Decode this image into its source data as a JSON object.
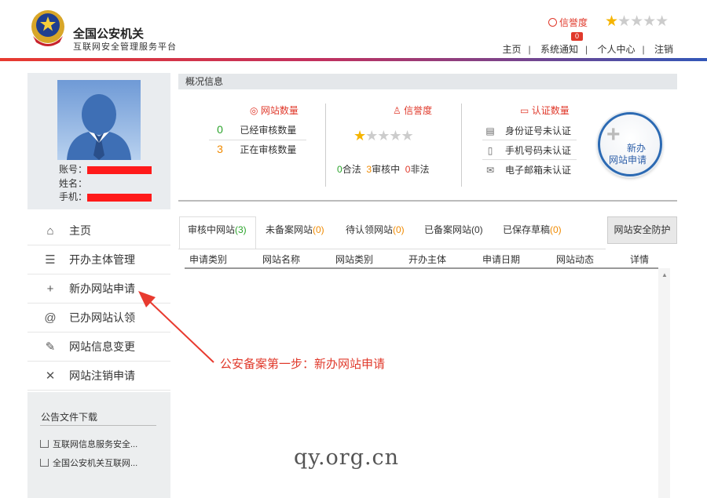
{
  "header": {
    "title": "全国公安机关",
    "subtitle": "互联网安全管理服务平台",
    "credit_label": "信誉度",
    "badge_count": "0",
    "rating": {
      "value": 1,
      "max": 5
    },
    "nav": [
      "主页",
      "系统通知",
      "个人中心",
      "注销"
    ]
  },
  "profile": {
    "account_label": "账号：",
    "name_label": "姓名：",
    "phone_label": "手机："
  },
  "menu": [
    {
      "icon": "home-icon",
      "label": "主页"
    },
    {
      "icon": "list-icon",
      "label": "开办主体管理"
    },
    {
      "icon": "plus-icon",
      "label": "新办网站申请"
    },
    {
      "icon": "at-icon",
      "label": "已办网站认领"
    },
    {
      "icon": "edit-icon",
      "label": "网站信息变更"
    },
    {
      "icon": "close-icon",
      "label": "网站注销申请"
    }
  ],
  "downloads": {
    "title": "公告文件下载",
    "items": [
      "互联网信息服务安全...",
      "全国公安机关互联网..."
    ]
  },
  "overview": {
    "title": "概况信息",
    "site_count": {
      "title": "网站数量",
      "rows": [
        {
          "value": "0",
          "label": "已经审核数量"
        },
        {
          "value": "3",
          "label": "正在审核数量"
        }
      ]
    },
    "credit": {
      "title": "信誉度",
      "rating": 1,
      "legal": "0",
      "legal_label": "合法",
      "reviewing": "3",
      "reviewing_label": "审核中",
      "illegal": "0",
      "illegal_label": "非法"
    },
    "cert": {
      "title": "认证数量",
      "rows": [
        "身份证号未认证",
        "手机号码未认证",
        "电子邮箱未认证"
      ]
    },
    "new_button": {
      "line1": "新办",
      "line2": "网站申请"
    }
  },
  "tabs": [
    {
      "label": "审核中网站",
      "count": "(3)"
    },
    {
      "label": "未备案网站",
      "count": "(0)"
    },
    {
      "label": "待认领网站",
      "count": "(0)"
    },
    {
      "label": "已备案网站",
      "count": "(0)"
    },
    {
      "label": "已保存草稿",
      "count": "(0)"
    }
  ],
  "defense_button": "网站安全防护",
  "table_headers": [
    "申请类别",
    "网站名称",
    "网站类别",
    "开办主体",
    "申请日期",
    "网站动态",
    "详情"
  ],
  "annotation": "公安备案第一步：新办网站申请",
  "watermark": "qy.org.cn",
  "colors": {
    "accent_red": "#e0392b",
    "accent_blue": "#2c5ea8",
    "green": "#2aa32a",
    "orange": "#f08a00"
  }
}
